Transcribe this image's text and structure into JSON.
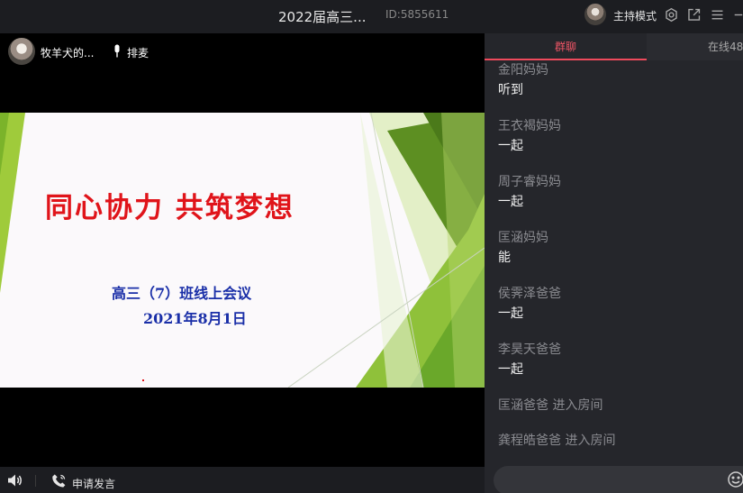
{
  "window": {
    "title": "2022届高三...",
    "room_id": "ID:5855611",
    "host_mode_label": "主持模式"
  },
  "presenter": {
    "name": "牧羊犬的...",
    "mic_label": "排麦"
  },
  "slide": {
    "title": "同心协力 共筑梦想",
    "subtitle": "高三（7）班线上会议",
    "date": "2021年8月1日"
  },
  "bottom_bar": {
    "apply_speak_label": "申请发言"
  },
  "panel": {
    "tabs": [
      {
        "label": "群聊",
        "active": true
      },
      {
        "label": "在线48",
        "active": false
      }
    ],
    "messages": [
      {
        "sender": "金阳妈妈",
        "content": "听到"
      },
      {
        "sender": "王衣褐妈妈",
        "content": "一起"
      },
      {
        "sender": "周子睿妈妈",
        "content": "一起"
      },
      {
        "sender": "匡涵妈妈",
        "content": "能"
      },
      {
        "sender": "侯霁泽爸爸",
        "content": "一起"
      },
      {
        "sender": "李昊天爸爸",
        "content": "一起"
      }
    ],
    "system_messages": [
      "匡涵爸爸 进入房间",
      "龚程皓爸爸 进入房间"
    ]
  },
  "colors": {
    "accent": "#ee4a5c",
    "slide_title": "#e0141a",
    "slide_text": "#1a2fa8",
    "panel_bg": "#25262b",
    "topbar_bg": "#1c1d21"
  },
  "icons": [
    "volume-icon",
    "phone-icon",
    "microphone-icon",
    "settings-icon",
    "popout-icon",
    "menu-icon",
    "minimize-icon",
    "emoji-icon"
  ]
}
